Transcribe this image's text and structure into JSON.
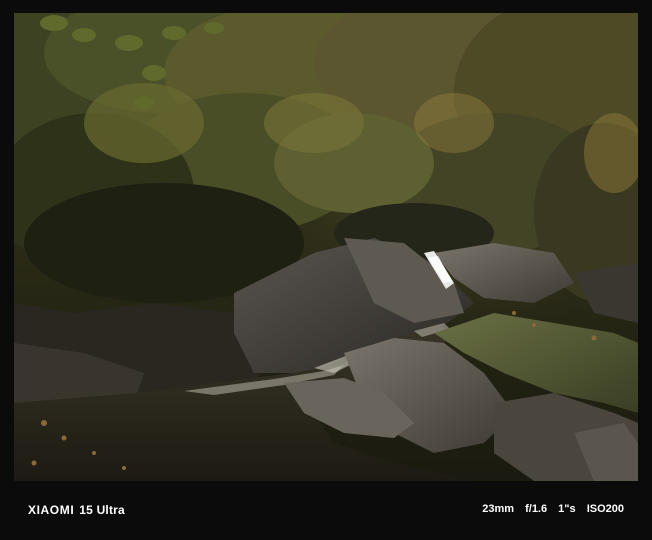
{
  "photo": {
    "subject": "forest-stream-photo"
  },
  "caption": {
    "brand": "XIAOMI",
    "model": "15 Ultra",
    "focal_length": "23mm",
    "aperture": "f/1.6",
    "shutter": "1\"s",
    "iso": "ISO200"
  },
  "colors": {
    "frame_background": "#0b0b0b",
    "caption_text": "#ffffff"
  }
}
